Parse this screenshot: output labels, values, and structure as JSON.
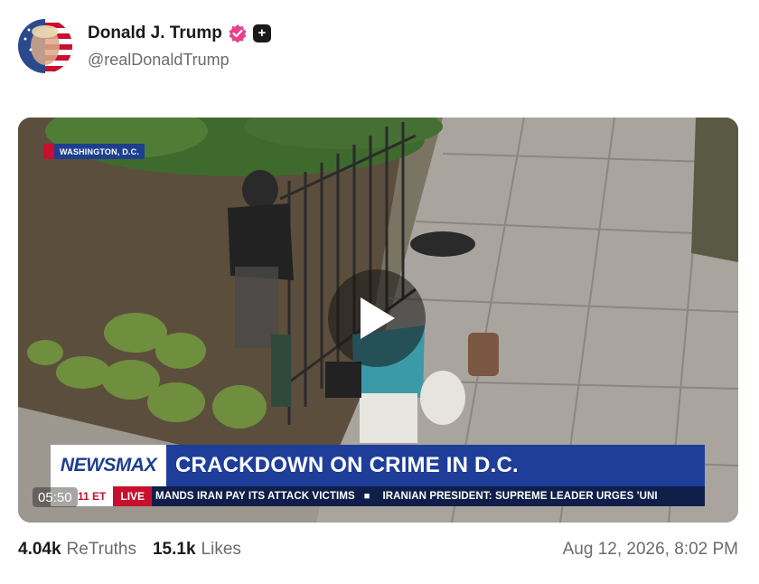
{
  "post": {
    "author": {
      "display_name": "Donald J. Trump",
      "handle": "@realDonaldTrump",
      "verified_icon": "verified-badge-icon",
      "extra_badge_icon": "plus-badge-icon",
      "verified_color": "#e8418a"
    },
    "media": {
      "type": "video",
      "duration": "05:50",
      "location_tag": "WASHINGTON, D.C.",
      "network_logo": "NEWSMAX",
      "headline": "CRACKDOWN ON CRIME IN D.C.",
      "ticker_time": "11 ET",
      "ticker_live": "LIVE",
      "ticker_items": [
        "MANDS IRAN PAY ITS ATTACK VICTIMS",
        "IRANIAN PRESIDENT: SUPREME LEADER URGES 'UNI"
      ],
      "play_icon": "play-icon"
    },
    "stats": {
      "retruths_count": "4.04k",
      "retruths_label": "ReTruths",
      "likes_count": "15.1k",
      "likes_label": "Likes"
    },
    "timestamp": "Aug 12, 2026, 8:02 PM"
  }
}
